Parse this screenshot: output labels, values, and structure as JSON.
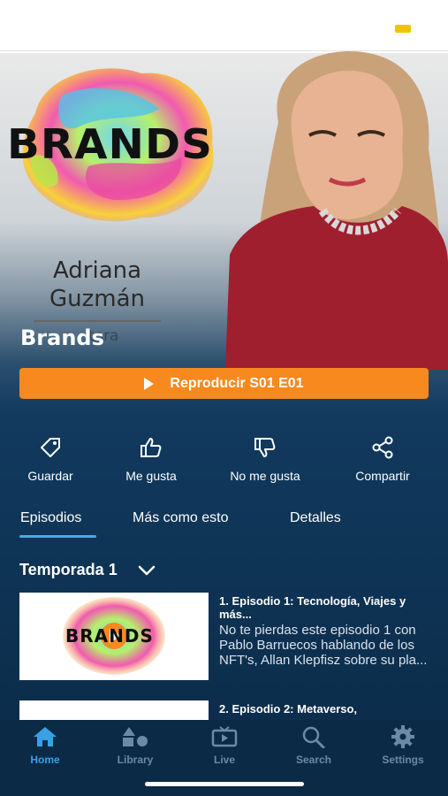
{
  "hero": {
    "logo_word": "BRANDS",
    "host_name_line1": "Adriana",
    "host_name_line2": "Guzmán",
    "host_role_partial": "tora",
    "show_title": "Brands"
  },
  "play_button": {
    "label": "Reproducir S01  E01"
  },
  "actions": {
    "save": "Guardar",
    "like": "Me gusta",
    "dislike": "No me gusta",
    "share": "Compartir"
  },
  "tabs": {
    "episodes": "Episodios",
    "more_like_this": "Más como esto",
    "details": "Detalles"
  },
  "season": {
    "label": "Temporada 1"
  },
  "episodes": [
    {
      "title": "1. Episodio 1: Tecnología, Viajes y más...",
      "description": "No te pierdas este episodio 1 con Pablo Barruecos hablando de los NFT's, Allan Klepfisz sobre su pla...",
      "thumb_text": "BRANDS"
    },
    {
      "title": "2. Episodio 2: Metaverso,",
      "description": "",
      "thumb_text": ""
    }
  ],
  "bottom_nav": {
    "home": "Home",
    "library": "Library",
    "live": "Live",
    "search": "Search",
    "settings": "Settings"
  },
  "colors": {
    "accent_orange": "#f7891f",
    "tab_active": "#4aa9e8",
    "nav_active": "#3aa0e6",
    "background_navy": "#0f3557"
  }
}
